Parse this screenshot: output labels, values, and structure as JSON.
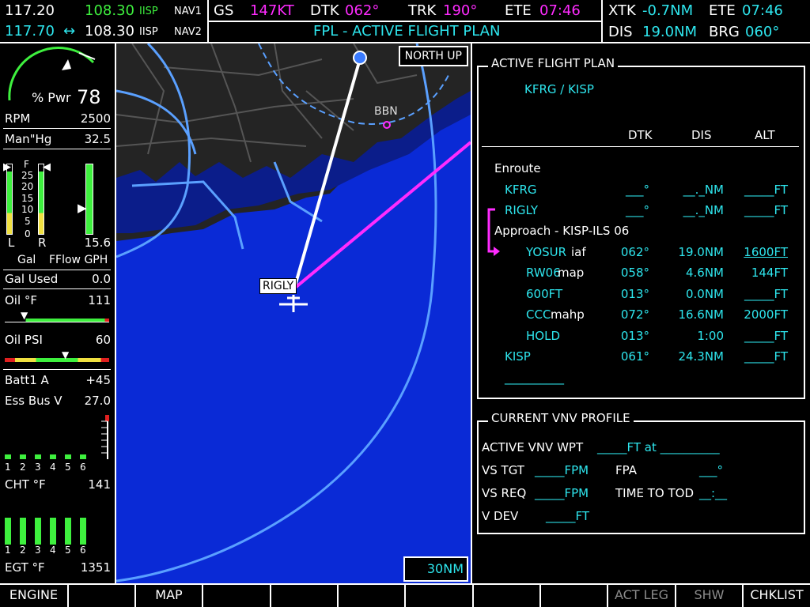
{
  "nav": {
    "com1_active": "117.20",
    "com1_standby": "108.30",
    "com1_ident": "IISP",
    "com1_label": "NAV1",
    "com2_active": "117.70",
    "swap_icon": "↔",
    "com2_standby": "108.30",
    "com2_ident": "IISP",
    "com2_label": "NAV2"
  },
  "datafields": {
    "gs_label": "GS",
    "gs_value": "147KT",
    "dtk_label": "DTK",
    "dtk_value": "062°",
    "trk_label": "TRK",
    "trk_value": "190°",
    "ete_label": "ETE",
    "ete_value": "07:46",
    "xtk_label": "XTK",
    "xtk_value": "-0.7NM",
    "ete2_label": "ETE",
    "ete2_value": "07:46",
    "dis_label": "DIS",
    "dis_value": "19.0NM",
    "brg_label": "BRG",
    "brg_value": "060°"
  },
  "page_title": "FPL - ACTIVE FLIGHT PLAN",
  "engine": {
    "pwr_label": "% Pwr",
    "pwr_value": "78",
    "pwr_fraction": 0.78,
    "rpm_label": "RPM",
    "rpm_value": "2500",
    "manhg_label": "Man\"Hg",
    "manhg_value": "32.5",
    "fuel_scale": [
      "F",
      "25",
      "20",
      "15",
      "10",
      "5",
      "0"
    ],
    "fuel_left": "L",
    "fuel_right": "R",
    "fflow_value": "15.6",
    "gal_label": "Gal",
    "fflow_label": "FFlow GPH",
    "gal_used_label": "Gal Used",
    "gal_used_value": "0.0",
    "oil_temp_label": "Oil °F",
    "oil_temp_value": "111",
    "oil_psi_label": "Oil PSI",
    "oil_psi_value": "60",
    "batt_label": "Batt1 A",
    "batt_value": "+45",
    "essbus_label": "Ess Bus V",
    "essbus_value": "27.0",
    "cyl_numbers": [
      "1",
      "2",
      "3",
      "4",
      "5",
      "6"
    ],
    "cht_label": "CHT °F",
    "cht_value": "141",
    "egt_label": "EGT °F",
    "egt_value": "1351"
  },
  "map": {
    "orientation": "NORTH UP",
    "waypoint_label": "RIGLY",
    "airport_label": "BBN",
    "range": "30NM"
  },
  "fpl": {
    "box_title": "ACTIVE FLIGHT PLAN",
    "route": "KFRG / KISP",
    "col_dtk": "DTK",
    "col_dis": "DIS",
    "col_alt": "ALT",
    "enroute_header": "Enroute",
    "approach_header": "Approach - KISP-ILS 06",
    "rows": [
      {
        "name": "KFRG",
        "suffix": "",
        "dtk": "___°",
        "dis": "__._NM",
        "alt": "_____FT"
      },
      {
        "name": "RIGLY",
        "suffix": "",
        "dtk": "___°",
        "dis": "__._NM",
        "alt": "_____FT"
      },
      {
        "name": "YOSUR",
        "suffix": "iaf",
        "dtk": "062°",
        "dis": "19.0NM",
        "alt": "1600FT"
      },
      {
        "name": "RW06",
        "suffix": "map",
        "dtk": "058°",
        "dis": "4.6NM",
        "alt": "144FT"
      },
      {
        "name": "600FT",
        "suffix": "",
        "dtk": "013°",
        "dis": "0.0NM",
        "alt": "_____FT"
      },
      {
        "name": "CCC",
        "suffix": "mahp",
        "dtk": "072°",
        "dis": "16.6NM",
        "alt": "2000FT"
      },
      {
        "name": "HOLD",
        "suffix": "",
        "dtk": "013°",
        "dis": "1:00",
        "alt": "_____FT"
      },
      {
        "name": "KISP",
        "suffix": "",
        "dtk": "061°",
        "dis": "24.3NM",
        "alt": "_____FT"
      }
    ],
    "empty_row": "__________"
  },
  "vnv": {
    "box_title": "CURRENT VNV PROFILE",
    "active_wpt_label": "ACTIVE VNV WPT",
    "active_wpt_value": "_____FT at __________",
    "vs_tgt_label": "VS TGT",
    "vs_tgt_value": "_____FPM",
    "fpa_label": "FPA",
    "fpa_value": "___°",
    "vs_req_label": "VS REQ",
    "vs_req_value": "_____FPM",
    "tod_label": "TIME TO TOD",
    "tod_value": "__:__",
    "vdev_label": "V DEV",
    "vdev_value": "_____FT"
  },
  "softkeys": [
    "ENGINE",
    "",
    "MAP",
    "",
    "",
    "",
    "",
    "",
    "",
    "ACT LEG",
    "SHW CHRT",
    "CHKLIST"
  ],
  "colors": {
    "cyan": "#2ee6ee",
    "magenta": "#ff2bff",
    "green": "#3ef03e",
    "water": "#0a2ad6",
    "land": "#202020"
  }
}
